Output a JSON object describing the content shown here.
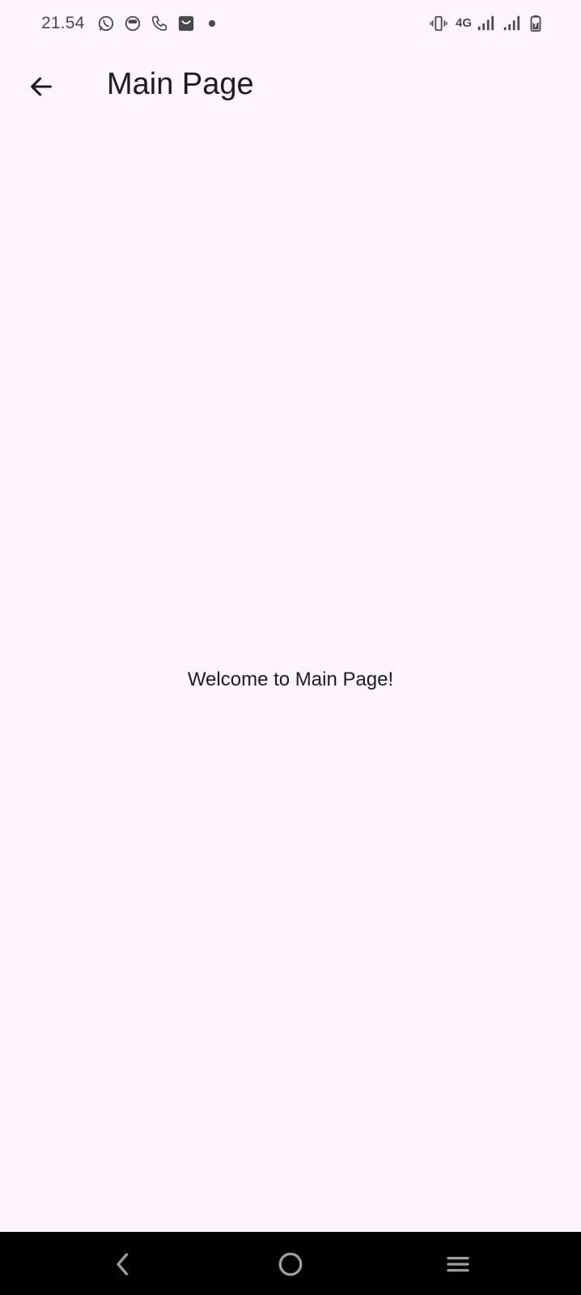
{
  "status_bar": {
    "time": "21.54",
    "network": "4G",
    "icons": [
      "whatsapp-icon",
      "app-notification-icon",
      "phone-call-icon",
      "shopping-bag-icon",
      "dot-icon",
      "vibrate-icon",
      "signal-icon",
      "signal-icon",
      "battery-charging-icon"
    ]
  },
  "app_bar": {
    "title": "Main Page",
    "back_icon": "arrow-left-icon"
  },
  "main": {
    "welcome_text": "Welcome to Main Page!"
  },
  "nav_bar": {
    "buttons": [
      "back-icon",
      "home-icon",
      "recents-icon"
    ]
  },
  "colors": {
    "background": "#fdf7fd",
    "text": "#1d1b20",
    "status_text": "#4a4a4a",
    "nav_background": "#000000",
    "nav_icon": "#9e9e9e"
  }
}
